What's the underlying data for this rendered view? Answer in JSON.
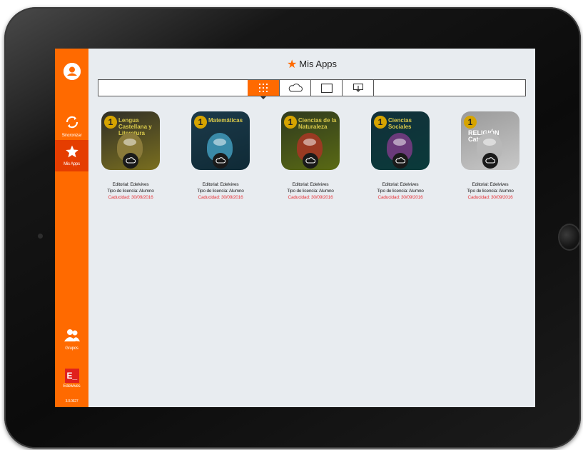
{
  "sidebar": {
    "sync_label": "Sincronizar",
    "myapps_label": "Mis Apps",
    "groups_label": "Grupos",
    "brand_logo": "E_",
    "brand_label": "Edelvives",
    "version": "3.0.0627"
  },
  "header": {
    "title": "Mis Apps"
  },
  "filters": [
    "grid-view",
    "cloud",
    "device",
    "download"
  ],
  "apps": [
    {
      "grade": "1",
      "title": "Lengua Castellana y Literatura",
      "publisher": "Editorial: Edelvives",
      "license": "Tipo de licencia: Alumno",
      "expiry": "Caducidad: 30/09/2016",
      "color_top": "#2f2e27",
      "color_bottom": "#7a6f1f",
      "figure": "#8a7a3a"
    },
    {
      "grade": "1",
      "title": "Matemáticas",
      "publisher": "Editorial: Edelvives",
      "license": "Tipo de licencia: Alumno",
      "expiry": "Caducidad: 30/09/2016",
      "color_top": "#1c3a4a",
      "color_bottom": "#0f2a36",
      "figure": "#3a8aa8"
    },
    {
      "grade": "1",
      "title": "Ciencias de la Naturaleza",
      "publisher": "Editorial: Edelvives",
      "license": "Tipo de licencia: Alumno",
      "expiry": "Caducidad: 30/09/2016",
      "color_top": "#2f3a1e",
      "color_bottom": "#5a6a14",
      "figure": "#9a3a22"
    },
    {
      "grade": "1",
      "title": "Ciencias Sociales",
      "publisher": "Editorial: Edelvives",
      "license": "Tipo de licencia: Alumno",
      "expiry": "Caducidad: 30/09/2016",
      "color_top": "#12303a",
      "color_bottom": "#0a3a3a",
      "figure": "#6a3a7a"
    },
    {
      "grade": "1",
      "title": "RELIGIÓN Católica",
      "publisher": "Editorial: Edelvives",
      "license": "Tipo de licencia: Alumno",
      "expiry": "Caducidad: 30/09/2016",
      "color_top": "#9a9a9a",
      "color_bottom": "#c8c8c8",
      "figure": "#b8b8b8"
    }
  ],
  "colors": {
    "accent": "#ff6a00",
    "active": "#e53d00",
    "expiry": "#e8343a"
  }
}
